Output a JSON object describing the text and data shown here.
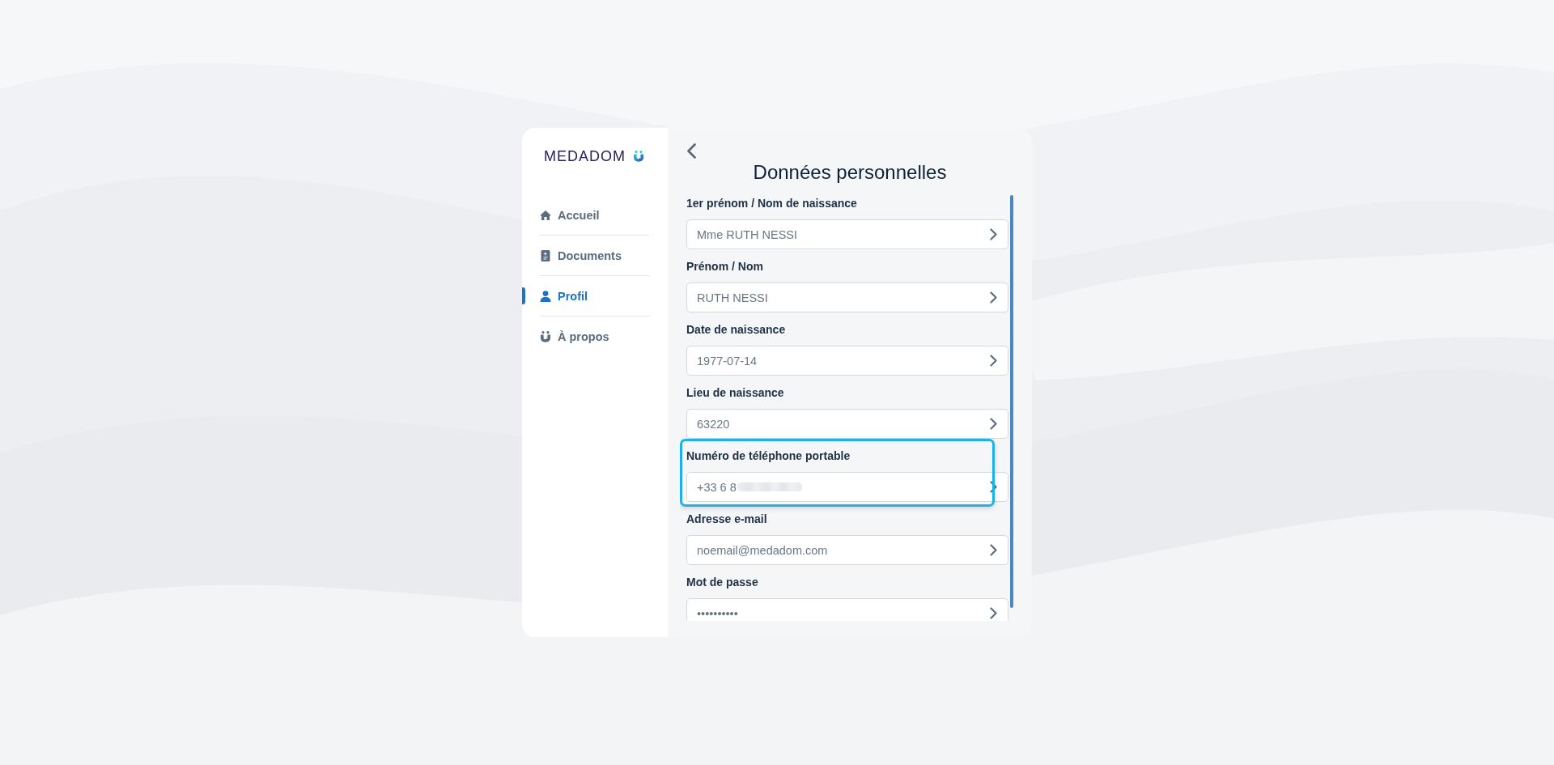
{
  "sidebar": {
    "logo": "MEDADOM",
    "nav": [
      {
        "label": "Accueil",
        "selected": false
      },
      {
        "label": "Documents",
        "selected": false
      },
      {
        "label": "Profil",
        "selected": true
      },
      {
        "label": "À propos",
        "selected": false
      }
    ]
  },
  "panel": {
    "title": "Données personnelles",
    "fields": [
      {
        "label": "1er prénom / Nom de naissance",
        "value": "Mme RUTH NESSI",
        "highlighted": false,
        "blurred": false
      },
      {
        "label": "Prénom / Nom",
        "value": "RUTH NESSI",
        "highlighted": false,
        "blurred": false
      },
      {
        "label": "Date de naissance",
        "value": "1977-07-14",
        "highlighted": false,
        "blurred": false
      },
      {
        "label": "Lieu de naissance",
        "value": "63220",
        "highlighted": false,
        "blurred": false
      },
      {
        "label": "Numéro de téléphone portable",
        "value": "+33 6 8",
        "highlighted": true,
        "blurred": true
      },
      {
        "label": "Adresse e-mail",
        "value": "noemail@medadom.com",
        "highlighted": false,
        "blurred": false
      },
      {
        "label": "Mot de passe",
        "value": "••••••••••",
        "highlighted": false,
        "blurred": false
      }
    ]
  }
}
